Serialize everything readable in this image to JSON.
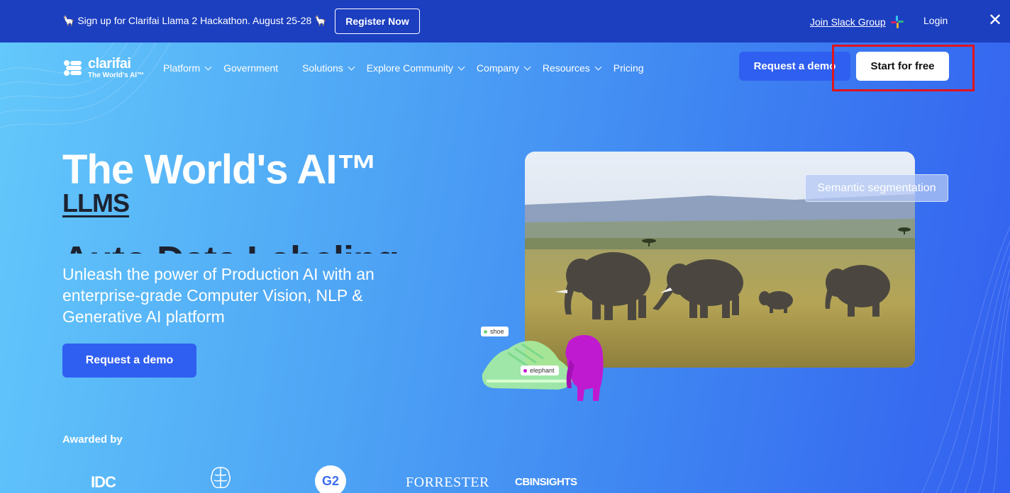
{
  "announcement": {
    "message": "🦙 Sign up for Clarifai Llama 2 Hackathon. August 25-28 🦙",
    "register_label": "Register Now",
    "slack_label": "Join Slack Group",
    "login_label": "Login",
    "close_icon": "close-icon"
  },
  "brand": {
    "name": "clarifai",
    "tagline": "The World's AI™"
  },
  "nav": {
    "items": [
      {
        "label": "Platform",
        "has_dropdown": true
      },
      {
        "label": "Government",
        "has_dropdown": false
      },
      {
        "label": "Solutions",
        "has_dropdown": true
      },
      {
        "label": "Explore Community",
        "has_dropdown": true
      },
      {
        "label": "Company",
        "has_dropdown": true
      },
      {
        "label": "Resources",
        "has_dropdown": true
      },
      {
        "label": "Pricing",
        "has_dropdown": false
      }
    ],
    "request_demo_label": "Request a demo",
    "start_free_label": "Start for free"
  },
  "hero": {
    "title": "The World's AI™",
    "rotating_primary": "LLMS",
    "rotating_secondary": "Auto Data Labeling",
    "subtitle": "Unleash the power of Production AI with an enterprise-grade Computer Vision, NLP & Generative AI platform",
    "cta_label": "Request a demo"
  },
  "visual": {
    "segmentation_label": "Semantic segmentation",
    "chip_shoe": "shoe",
    "chip_elephant": "elephant"
  },
  "awards": {
    "heading": "Awarded by",
    "logos": [
      "IDC",
      "G2",
      "FORRESTER",
      "CBINSIGHTS"
    ]
  },
  "colors": {
    "announcement_bg": "#1c3fc0",
    "primary_button": "#2f5ff0",
    "highlight_box": "#e0141c"
  }
}
